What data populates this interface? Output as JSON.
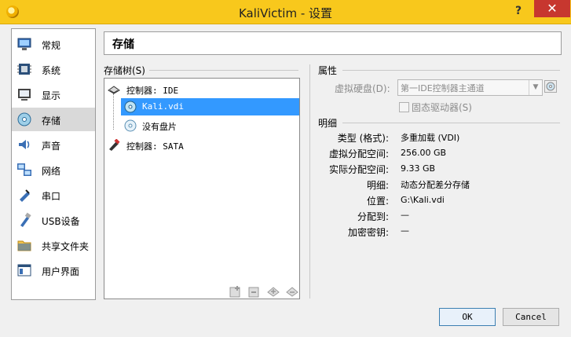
{
  "window": {
    "title": "KaliVictim - 设置",
    "help_label": "?",
    "close_label": "✕"
  },
  "sidebar": {
    "items": [
      {
        "label": "常规",
        "icon": "general-icon"
      },
      {
        "label": "系统",
        "icon": "system-icon"
      },
      {
        "label": "显示",
        "icon": "display-icon"
      },
      {
        "label": "存储",
        "icon": "storage-icon",
        "selected": true
      },
      {
        "label": "声音",
        "icon": "audio-icon"
      },
      {
        "label": "网络",
        "icon": "network-icon"
      },
      {
        "label": "串口",
        "icon": "serial-port-icon"
      },
      {
        "label": "USB设备",
        "icon": "usb-icon"
      },
      {
        "label": "共享文件夹",
        "icon": "shared-folder-icon"
      },
      {
        "label": "用户界面",
        "icon": "user-interface-icon"
      }
    ]
  },
  "page": {
    "title": "存储"
  },
  "storage_tree": {
    "label": "存储树(S)",
    "items": [
      {
        "label": "控制器: IDE",
        "icon": "ide-controller-icon"
      },
      {
        "label": "Kali.vdi",
        "icon": "hard-disk-icon",
        "selected": true
      },
      {
        "label": "没有盘片",
        "icon": "optical-disc-icon"
      },
      {
        "label": "控制器: SATA",
        "icon": "sata-controller-icon"
      }
    ]
  },
  "attributes": {
    "label": "属性",
    "virtual_disk_label": "虚拟硬盘(D):",
    "virtual_disk_value": "第一IDE控制器主通道",
    "ssd_label": "固态驱动器(S)"
  },
  "details": {
    "label": "明细",
    "rows": [
      {
        "label": "类型 (格式):",
        "value": "多重加载 (VDI)"
      },
      {
        "label": "虚拟分配空间:",
        "value": "256.00 GB"
      },
      {
        "label": "实际分配空间:",
        "value": "9.33 GB"
      },
      {
        "label": "明细:",
        "value": "动态分配差分存储"
      },
      {
        "label": "位置:",
        "value": "G:\\Kali.vdi"
      },
      {
        "label": "分配到:",
        "value": "—"
      },
      {
        "label": "加密密钥:",
        "value": "—"
      }
    ]
  },
  "buttons": {
    "ok": "OK",
    "cancel": "Cancel"
  },
  "colors": {
    "titlebar": "#f8c81c",
    "selection": "#3399ff",
    "close": "#c7372f"
  }
}
